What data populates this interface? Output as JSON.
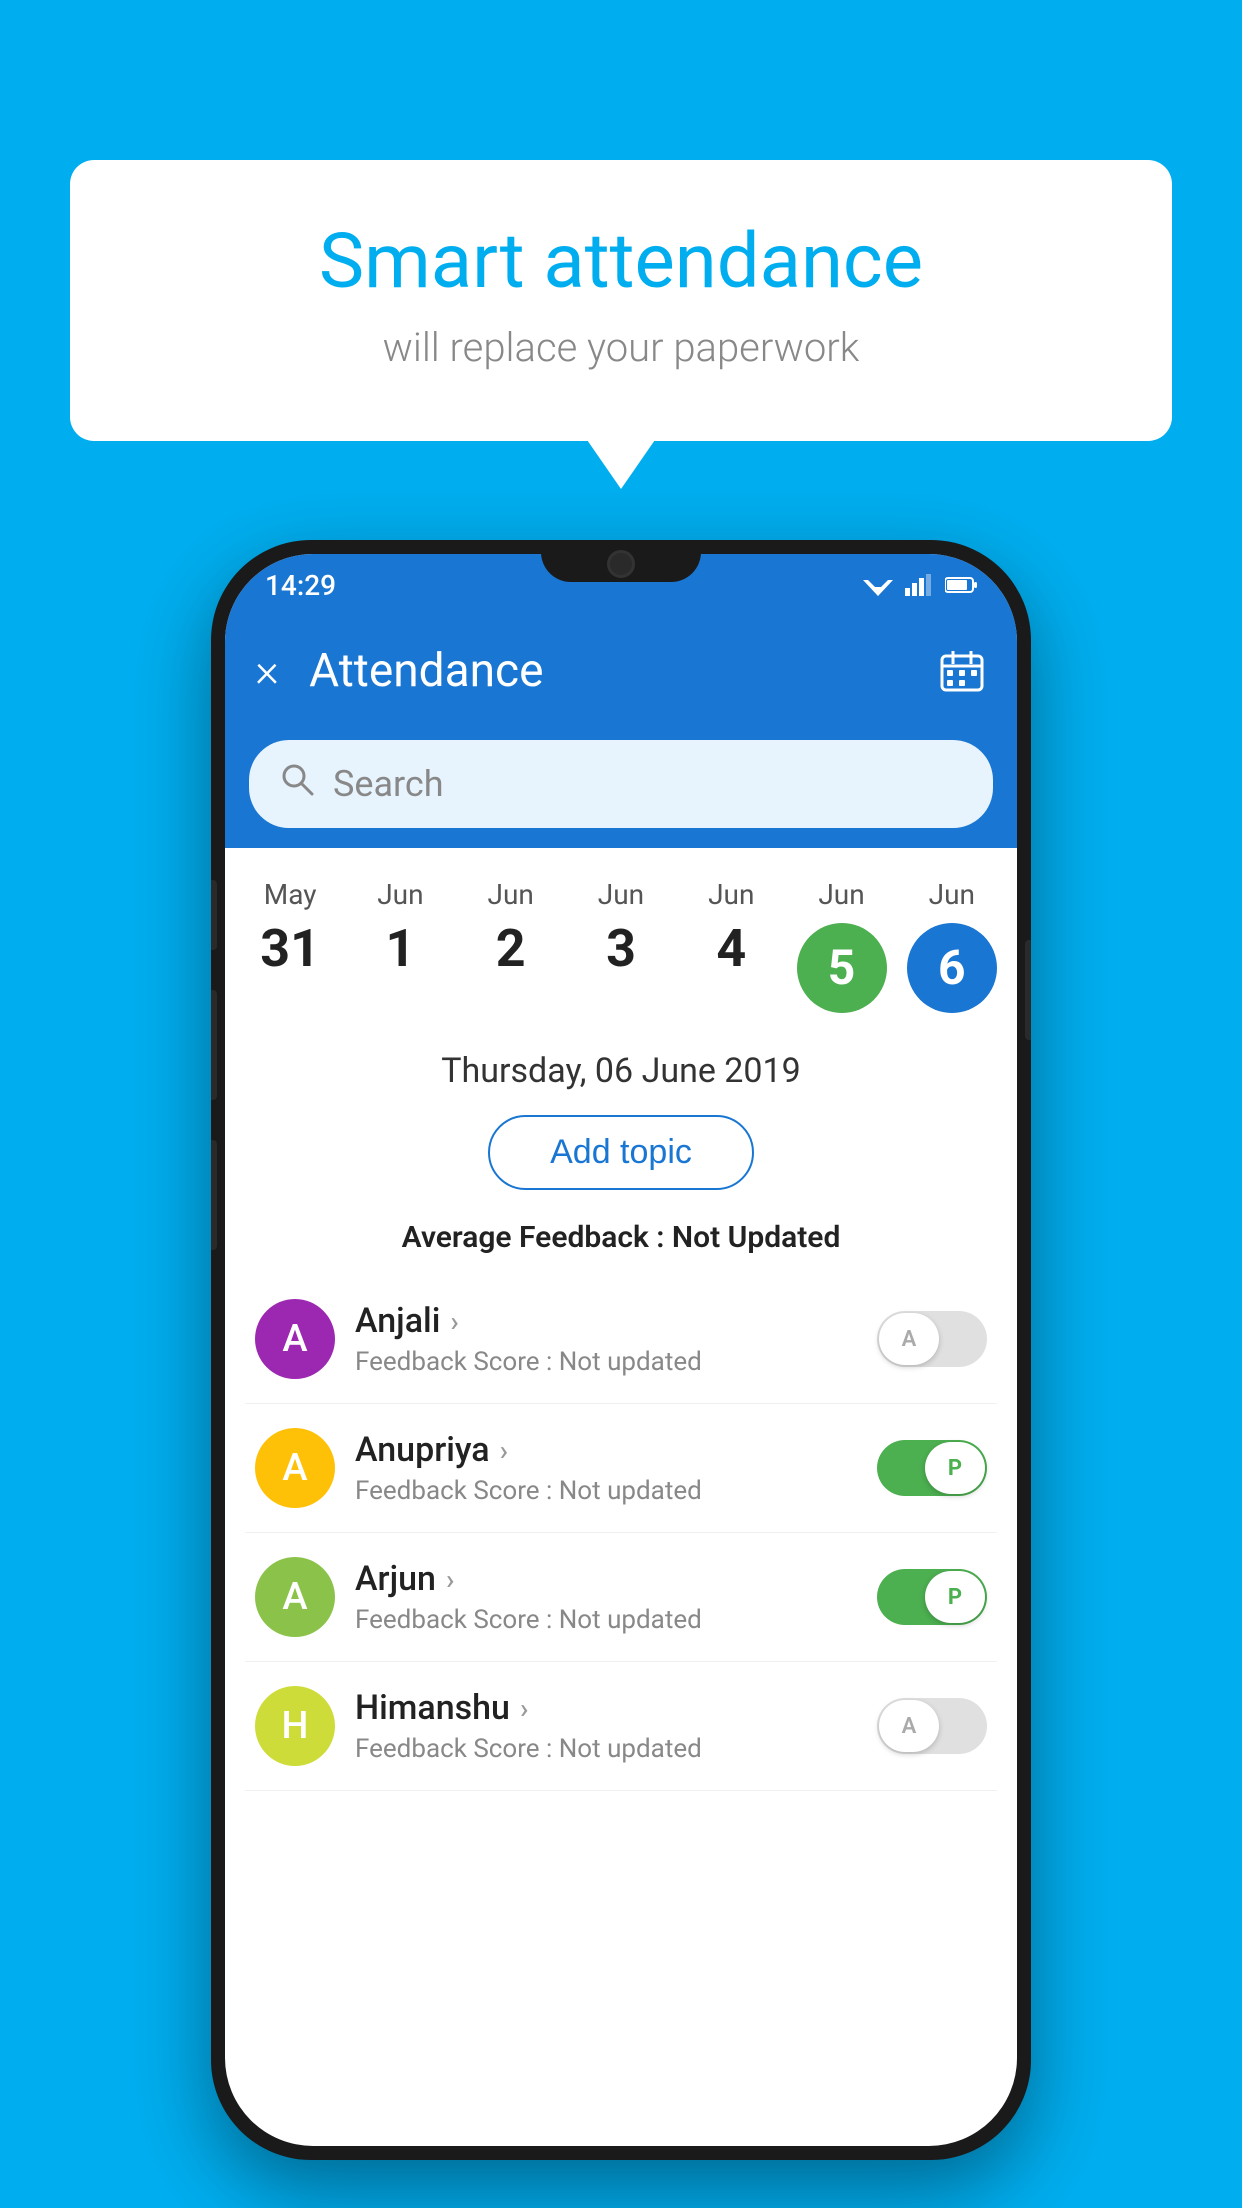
{
  "background_color": "#00AEEF",
  "speech_bubble": {
    "title": "Smart attendance",
    "subtitle": "will replace your paperwork"
  },
  "status_bar": {
    "time": "14:29"
  },
  "app_bar": {
    "title": "Attendance",
    "close_label": "×",
    "calendar_icon": "📅"
  },
  "search": {
    "placeholder": "Search"
  },
  "calendar": {
    "dates": [
      {
        "month": "May",
        "day": "31",
        "highlight": null
      },
      {
        "month": "Jun",
        "day": "1",
        "highlight": null
      },
      {
        "month": "Jun",
        "day": "2",
        "highlight": null
      },
      {
        "month": "Jun",
        "day": "3",
        "highlight": null
      },
      {
        "month": "Jun",
        "day": "4",
        "highlight": null
      },
      {
        "month": "Jun",
        "day": "5",
        "highlight": "green"
      },
      {
        "month": "Jun",
        "day": "6",
        "highlight": "blue"
      }
    ]
  },
  "selected_date": "Thursday, 06 June 2019",
  "add_topic_label": "Add topic",
  "avg_feedback_label": "Average Feedback :",
  "avg_feedback_value": "Not Updated",
  "students": [
    {
      "name": "Anjali",
      "initial": "A",
      "avatar_color": "purple",
      "feedback": "Feedback Score : Not updated",
      "attendance": "inactive",
      "attendance_label": "A"
    },
    {
      "name": "Anupriya",
      "initial": "A",
      "avatar_color": "yellow",
      "feedback": "Feedback Score : Not updated",
      "attendance": "active",
      "attendance_label": "P"
    },
    {
      "name": "Arjun",
      "initial": "A",
      "avatar_color": "green",
      "feedback": "Feedback Score : Not updated",
      "attendance": "active",
      "attendance_label": "P"
    },
    {
      "name": "Himanshu",
      "initial": "H",
      "avatar_color": "lime",
      "feedback": "Feedback Score : Not updated",
      "attendance": "inactive",
      "attendance_label": "A"
    }
  ]
}
